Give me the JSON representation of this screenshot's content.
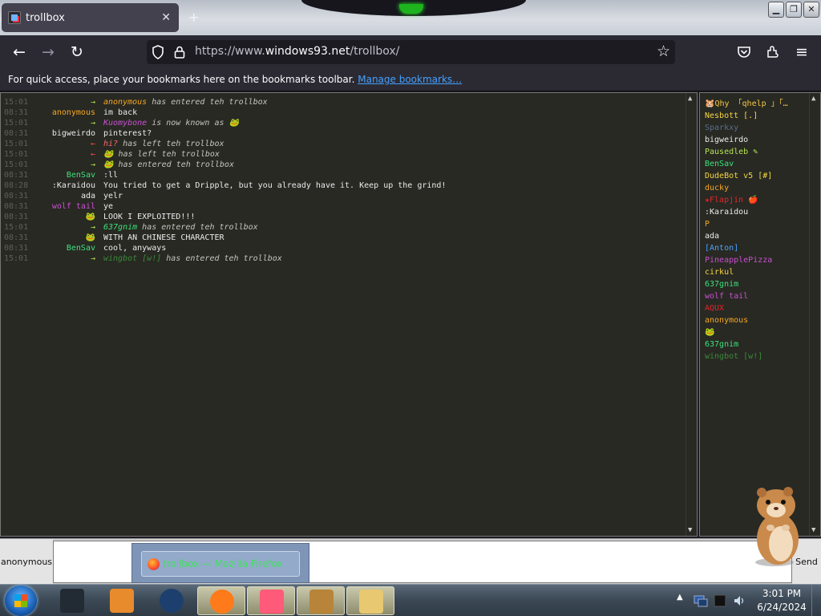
{
  "browser": {
    "tab_title": "trollbox",
    "tab_close": "✕",
    "new_tab": "+",
    "url_prefix": "https://www.",
    "url_domain": "windows93.net",
    "url_path": "/trollbox/",
    "bookmarks_text": "For quick access, place your bookmarks here on the bookmarks toolbar.",
    "bookmarks_link": "Manage bookmarks…"
  },
  "chat": {
    "messages": [
      {
        "time": "15:01",
        "nick": "→",
        "nick_color": "#b6e354",
        "text": "anonymous",
        "text_color": "#f5a623",
        "tail": " has entered teh trollbox",
        "sys": true
      },
      {
        "time": "08:31",
        "nick": "anonymous",
        "nick_color": "#f5a623",
        "text": "im back",
        "text_color": "#eaeaea",
        "tail": "",
        "sys": false
      },
      {
        "time": "15:01",
        "nick": "→",
        "nick_color": "#b6e354",
        "text": "Kuomybone",
        "text_color": "#c94fd1",
        "tail": " is now known as 🐸",
        "sys": true
      },
      {
        "time": "08:31",
        "nick": "bigweirdo",
        "nick_color": "#eaeaea",
        "text": "pinterest?",
        "text_color": "#eaeaea",
        "tail": "",
        "sys": false
      },
      {
        "time": "15:01",
        "nick": "←",
        "nick_color": "#ff4a4a",
        "text": "hi?",
        "text_color": "#ff6a6a",
        "tail": " has left teh trollbox",
        "sys": true
      },
      {
        "time": "15:01",
        "nick": "←",
        "nick_color": "#ff4a4a",
        "text": "🐸",
        "text_color": "#b6e354",
        "tail": " has left teh trollbox",
        "sys": true
      },
      {
        "time": "15:01",
        "nick": "→",
        "nick_color": "#b6e354",
        "text": "🐸",
        "text_color": "#b6e354",
        "tail": " has entered teh trollbox",
        "sys": true
      },
      {
        "time": "08:31",
        "nick": "BenSav",
        "nick_color": "#3ee07a",
        "text": ":ll",
        "text_color": "#eaeaea",
        "tail": "",
        "sys": false
      },
      {
        "time": "08:28",
        "nick": ":Karaidou",
        "nick_color": "#eaeaea",
        "text": "You tried to get a Dripple, but you already have it. Keep up the grind!",
        "text_color": "#eaeaea",
        "tail": "",
        "sys": false
      },
      {
        "time": "08:31",
        "nick": "ada",
        "nick_color": "#eaeaea",
        "text": "yelr",
        "text_color": "#eaeaea",
        "tail": "",
        "sys": false
      },
      {
        "time": "08:31",
        "nick": "wolf tail",
        "nick_color": "#c94fd1",
        "text": "ye",
        "text_color": "#eaeaea",
        "tail": "",
        "sys": false
      },
      {
        "time": "08:31",
        "nick": "🐸",
        "nick_color": "#b6e354",
        "text": "LOOK I EXPLOITED!!!",
        "text_color": "#eaeaea",
        "tail": "",
        "sys": false
      },
      {
        "time": "15:01",
        "nick": "→",
        "nick_color": "#b6e354",
        "text": "637gnim",
        "text_color": "#3ee07a",
        "tail": " has entered teh trollbox",
        "sys": true
      },
      {
        "time": "08:31",
        "nick": "🐸",
        "nick_color": "#b6e354",
        "text": "WITH AN CHINESE CHARACTER",
        "text_color": "#eaeaea",
        "tail": "",
        "sys": false
      },
      {
        "time": "08:31",
        "nick": "BenSav",
        "nick_color": "#3ee07a",
        "text": "cool, anyways",
        "text_color": "#eaeaea",
        "tail": "",
        "sys": false
      },
      {
        "time": "15:01",
        "nick": "→",
        "nick_color": "#b6e354",
        "text": "wingbot [w!]",
        "text_color": "#3a8a3a",
        "tail": " has entered teh trollbox",
        "sys": true
      }
    ]
  },
  "users": [
    {
      "name": "🐹Qhy 「qhelp 」「…",
      "color": "#f5c842"
    },
    {
      "name": "Nesbott [.]",
      "color": "#f5d742"
    },
    {
      "name": "Sparkxy",
      "color": "#5b6d8a"
    },
    {
      "name": "bigweirdo",
      "color": "#eaeaea"
    },
    {
      "name": "Pausedleb ✎",
      "color": "#b6e354"
    },
    {
      "name": "BenSav",
      "color": "#3ee07a"
    },
    {
      "name": "DudeBot v5 [#]",
      "color": "#f5d742"
    },
    {
      "name": "ducky",
      "color": "#f5a623"
    },
    {
      "name": "★Flapjin 🍎",
      "color": "#e0262a"
    },
    {
      "name": ":Karaidou",
      "color": "#eaeaea"
    },
    {
      "name": "P",
      "color": "#f5a623"
    },
    {
      "name": "ada",
      "color": "#eaeaea"
    },
    {
      "name": "[Anton]",
      "color": "#4aa3ff"
    },
    {
      "name": "PineapplePizza",
      "color": "#c94fd1"
    },
    {
      "name": "cirkul",
      "color": "#f5d742"
    },
    {
      "name": "637gnim",
      "color": "#3ee07a"
    },
    {
      "name": "wolf tail",
      "color": "#c94fd1"
    },
    {
      "name": "AQUX",
      "color": "#e0262a"
    },
    {
      "name": "anonymous",
      "color": "#f5a623"
    },
    {
      "name": "🐸",
      "color": "#b6e354"
    },
    {
      "name": "637gnim",
      "color": "#3ee07a"
    },
    {
      "name": "wingbot [w!]",
      "color": "#3a8a3a"
    }
  ],
  "input": {
    "nickname": "anonymous",
    "send_label": "Send",
    "value": ""
  },
  "preview": {
    "label": "trollbox — Mozilla Firefox"
  },
  "taskbar": {
    "time": "3:01 PM",
    "date": "6/24/2024",
    "items": [
      {
        "name": "terminal",
        "color": "#222a33",
        "active": false
      },
      {
        "name": "media-player",
        "color": "#e88b2c",
        "active": false
      },
      {
        "name": "app-globe",
        "color": "#1d3f6e",
        "active": false
      },
      {
        "name": "firefox",
        "color": "#ff7a1a",
        "active": true
      },
      {
        "name": "app-prism",
        "color": "#ff5a7a",
        "active": true
      },
      {
        "name": "trollbox-box",
        "color": "#b8843a",
        "active": true
      },
      {
        "name": "file-explorer",
        "color": "#e8c870",
        "active": true
      }
    ]
  }
}
